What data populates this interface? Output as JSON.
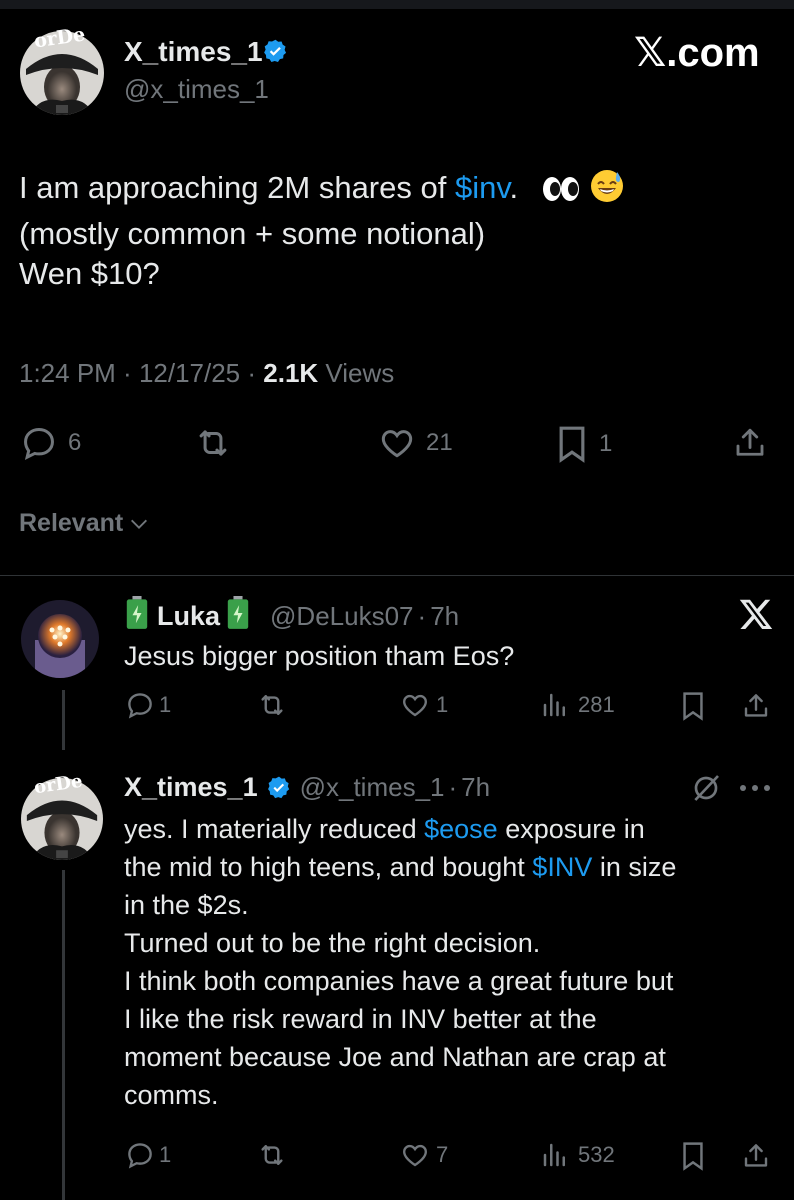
{
  "app": {
    "watermark": "𝕏.com"
  },
  "post": {
    "author_name": "X_times_1",
    "author_handle": "@x_times_1",
    "text_line1_before": "I am approaching 2M shares of ",
    "cashtag": "$inv",
    "text_line1_after": ".",
    "text_line2": "(mostly common + some notional)",
    "text_line3": "Wen $10?",
    "time": "1:24 PM",
    "sep1": " · ",
    "date": "12/17/25",
    "sep2": " · ",
    "views_count": "2.1K",
    "views_label": " Views",
    "stats": {
      "replies": "6",
      "reposts": "",
      "likes": "21",
      "bookmarks": "1"
    }
  },
  "sort": {
    "label": "Relevant"
  },
  "replies": [
    {
      "author_name": "Luka",
      "author_handle": "@DeLuks07",
      "sep": "·",
      "age": "7h",
      "text": "Jesus bigger position tham Eos?",
      "stats": {
        "replies": "1",
        "reposts": "",
        "likes": "1",
        "views": "281"
      }
    },
    {
      "author_name": "X_times_1",
      "author_handle": "@x_times_1",
      "sep": "·",
      "age": "7h",
      "l1_a": "yes.  I materially reduced ",
      "l1_tag": "$eose",
      "l1_b": " exposure in",
      "l2_a": "the mid to high teens, and bought ",
      "l2_tag": "$INV",
      "l2_b": " in size",
      "l3": "in the $2s.",
      "l4": "Turned out to be the right decision.",
      "l5": "I think both companies have a great future but",
      "l6": "I like the risk reward in INV better at the",
      "l7": "moment because Joe and Nathan are crap at",
      "l8": "comms.",
      "stats": {
        "replies": "1",
        "reposts": "",
        "likes": "7",
        "views": "532"
      }
    }
  ],
  "avatar_cap_text": "orDe",
  "colors": {
    "accent": "#1d9bf0",
    "muted": "#71767b",
    "text": "#e7e9ea",
    "bg": "#000000",
    "battery": "#3aa04a"
  },
  "icons": [
    "verified-badge-icon",
    "eyes-emoji-icon",
    "sweat-smile-emoji-icon",
    "reply-icon",
    "repost-icon",
    "like-icon",
    "bookmark-icon",
    "share-icon",
    "chevron-down-icon",
    "x-logo-icon",
    "grok-icon",
    "more-icon",
    "views-icon",
    "battery-emoji-icon"
  ]
}
